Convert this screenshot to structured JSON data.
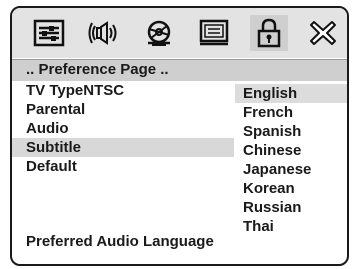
{
  "toolbar": {
    "icons": [
      {
        "name": "general-setup-icon"
      },
      {
        "name": "audio-setup-icon"
      },
      {
        "name": "video-setup-icon"
      },
      {
        "name": "screen-setup-icon"
      },
      {
        "name": "lock-icon",
        "selected": true
      },
      {
        "name": "exit-icon"
      }
    ]
  },
  "path": ".. Preference Page ..",
  "menu": {
    "items": [
      {
        "label": "TV TypeNTSC"
      },
      {
        "label": "Parental"
      },
      {
        "label": "Audio"
      },
      {
        "label": "Subtitle",
        "selected": true
      },
      {
        "label": "Default"
      }
    ]
  },
  "options": {
    "items": [
      {
        "label": "English",
        "selected": true
      },
      {
        "label": "French"
      },
      {
        "label": "Spanish"
      },
      {
        "label": "Chinese"
      },
      {
        "label": "Japanese"
      },
      {
        "label": "Korean"
      },
      {
        "label": "Russian"
      },
      {
        "label": "Thai"
      }
    ]
  },
  "status": "Preferred Audio Language"
}
